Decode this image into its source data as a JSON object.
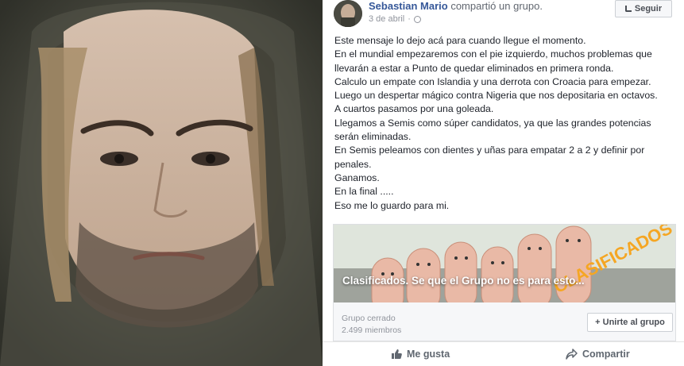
{
  "post": {
    "author": "Sebastian Mario",
    "action": "compartió un grupo.",
    "date": "3 de abril",
    "follow_label": "Seguir",
    "lines": [
      "Este mensaje lo dejo acá para cuando llegue el momento.",
      "En el mundial empezaremos con el pie izquierdo, muchos problemas que",
      "llevarán a estar a Punto de quedar eliminados en primera ronda.",
      "Calculo un empate con Islandia y una derrota con Croacia para empezar.",
      "Luego un despertar mágico contra Nigeria que nos depositaria en octavos.",
      "A cuartos pasamos por una goleada.",
      "Llegamos a Semis como súper candidatos, ya que las grandes potencias",
      "serán eliminadas.",
      "En Semis peleamos con dientes y uñas para empatar 2 a 2 y definir por",
      "penales.",
      "Ganamos.",
      "En la final .....",
      "Eso me lo guardo para mi."
    ],
    "card": {
      "title": "Clasificados. Se que el Grupo no es para esto...",
      "image_text": "CLASIFICADOS",
      "group_type": "Grupo cerrado",
      "members": "2.499 miembros",
      "join_label": "+ Unirte al grupo"
    },
    "like_label": "Me gusta",
    "share_label": "Compartir"
  },
  "colors": {
    "link": "#365899",
    "text": "#1d2129",
    "muted": "#90949c",
    "card_title": "#ffffff",
    "image_text": "#f5a623"
  }
}
